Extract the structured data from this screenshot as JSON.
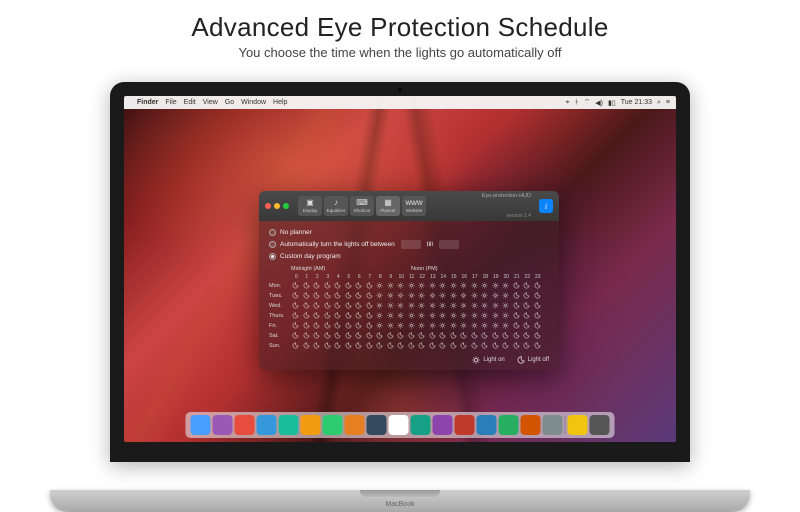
{
  "promo": {
    "title": "Advanced Eye Protection Schedule",
    "subtitle": "You choose the time when the lights go automatically off"
  },
  "menubar": {
    "app": "Finder",
    "items": [
      "File",
      "Edit",
      "View",
      "Go",
      "Window",
      "Help"
    ],
    "clock": "Tue 21:33"
  },
  "window": {
    "app_name": "Eye-protection-HUD",
    "version": "version 1.4",
    "tabs": [
      "Display",
      "Equalizer",
      "Shortcut",
      "Planner",
      "Website"
    ],
    "active_tab": 3,
    "options": {
      "no_planner": "No planner",
      "auto": "Automatically turn the lights off between",
      "auto_till": "till",
      "custom": "Custom day program"
    },
    "selected_option": "custom",
    "schedule": {
      "header_am": "Midnight (AM)",
      "header_pm": "Noon (PM)",
      "hours": [
        "0",
        "1",
        "2",
        "3",
        "4",
        "5",
        "6",
        "7",
        "8",
        "9",
        "10",
        "11",
        "12",
        "13",
        "14",
        "15",
        "16",
        "17",
        "18",
        "19",
        "20",
        "21",
        "22",
        "23"
      ],
      "days": [
        "Mon.",
        "Tues.",
        "Wed.",
        "Thurs.",
        "Fri.",
        "Sat.",
        "Sun."
      ],
      "grid": [
        [
          1,
          1,
          1,
          1,
          1,
          1,
          1,
          1,
          0,
          0,
          0,
          0,
          0,
          0,
          0,
          0,
          0,
          0,
          0,
          0,
          0,
          1,
          1,
          1
        ],
        [
          1,
          1,
          1,
          1,
          1,
          1,
          1,
          1,
          0,
          0,
          0,
          0,
          0,
          0,
          0,
          0,
          0,
          0,
          0,
          0,
          0,
          1,
          1,
          1
        ],
        [
          1,
          1,
          1,
          1,
          1,
          1,
          1,
          1,
          0,
          0,
          0,
          0,
          0,
          0,
          0,
          0,
          0,
          0,
          0,
          0,
          0,
          1,
          1,
          1
        ],
        [
          1,
          1,
          1,
          1,
          1,
          1,
          1,
          1,
          0,
          0,
          0,
          0,
          0,
          0,
          0,
          0,
          0,
          0,
          0,
          0,
          0,
          1,
          1,
          1
        ],
        [
          1,
          1,
          1,
          1,
          1,
          1,
          1,
          1,
          0,
          0,
          0,
          0,
          0,
          0,
          0,
          0,
          0,
          0,
          0,
          0,
          0,
          1,
          1,
          1
        ],
        [
          1,
          1,
          1,
          1,
          1,
          1,
          1,
          1,
          1,
          1,
          1,
          1,
          1,
          1,
          1,
          1,
          1,
          1,
          1,
          1,
          1,
          1,
          1,
          1
        ],
        [
          1,
          1,
          1,
          1,
          1,
          1,
          1,
          1,
          1,
          1,
          1,
          1,
          1,
          1,
          1,
          1,
          1,
          1,
          1,
          1,
          1,
          1,
          1,
          1
        ]
      ]
    },
    "legend": {
      "on": "Light on",
      "off": "Light off"
    }
  },
  "dock_colors": [
    "#4a9eff",
    "#9b59b6",
    "#e74c3c",
    "#3498db",
    "#1abc9c",
    "#f39c12",
    "#2ecc71",
    "#e67e22",
    "#34495e",
    "#fff",
    "#16a085",
    "#8e44ad",
    "#c0392b",
    "#2980b9",
    "#27ae60",
    "#d35400",
    "#7f8c8d",
    "#f1c40f",
    "#555"
  ],
  "laptop_model": "MacBook"
}
